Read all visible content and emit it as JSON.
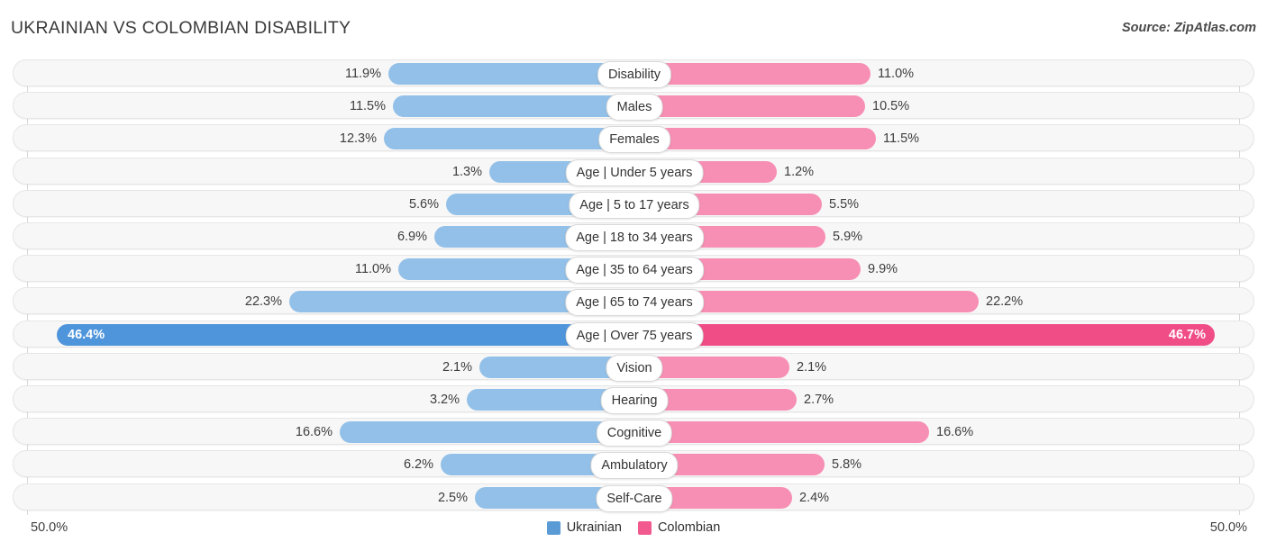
{
  "header": {
    "title": "UKRAINIAN VS COLOMBIAN DISABILITY",
    "source": "Source: ZipAtlas.com"
  },
  "axis": {
    "left_end": "50.0%",
    "right_end": "50.0%",
    "max": 50.0
  },
  "legend": {
    "items": [
      {
        "label": "Ukrainian",
        "color": "#5b9bd5"
      },
      {
        "label": "Colombian",
        "color": "#f2598f"
      }
    ]
  },
  "colors": {
    "left_bar": "#92c0e8",
    "left_bar_max": "#4e95db",
    "right_bar": "#f78eb4",
    "right_bar_max": "#f04d87",
    "row_track": "#f7f7f7",
    "gridline": "#d8d8d8"
  },
  "chart_data": {
    "type": "bar",
    "title": "UKRAINIAN VS COLOMBIAN DISABILITY",
    "subtitle": "Source: ZipAtlas.com",
    "orientation": "horizontal-diverging",
    "xlabel": "",
    "ylabel": "",
    "xlim": [
      50.0,
      50.0
    ],
    "grid": true,
    "legend_position": "bottom-center",
    "categories": [
      "Disability",
      "Males",
      "Females",
      "Age | Under 5 years",
      "Age | 5 to 17 years",
      "Age | 18 to 34 years",
      "Age | 35 to 64 years",
      "Age | 65 to 74 years",
      "Age | Over 75 years",
      "Vision",
      "Hearing",
      "Cognitive",
      "Ambulatory",
      "Self-Care"
    ],
    "series": [
      {
        "name": "Ukrainian",
        "values": [
          11.9,
          11.5,
          12.3,
          1.3,
          5.6,
          6.9,
          11.0,
          22.3,
          46.4,
          2.1,
          3.2,
          16.6,
          6.2,
          2.5
        ],
        "labels": [
          "11.9%",
          "11.5%",
          "12.3%",
          "1.3%",
          "5.6%",
          "6.9%",
          "11.0%",
          "22.3%",
          "46.4%",
          "2.1%",
          "3.2%",
          "16.6%",
          "6.2%",
          "2.5%"
        ]
      },
      {
        "name": "Colombian",
        "values": [
          11.0,
          10.5,
          11.5,
          1.2,
          5.5,
          5.9,
          9.9,
          22.2,
          46.7,
          2.1,
          2.7,
          16.6,
          5.8,
          2.4
        ],
        "labels": [
          "11.0%",
          "10.5%",
          "11.5%",
          "1.2%",
          "5.5%",
          "5.9%",
          "9.9%",
          "22.2%",
          "46.7%",
          "2.1%",
          "2.7%",
          "16.6%",
          "5.8%",
          "2.4%"
        ]
      }
    ]
  },
  "rows": [
    {
      "category": "Disability",
      "left_label": "11.9%",
      "right_label": "11.0%",
      "left_w": 273,
      "right_w": 262,
      "highlight": false
    },
    {
      "category": "Males",
      "left_label": "11.5%",
      "right_label": "10.5%",
      "left_w": 268,
      "right_w": 256,
      "highlight": false
    },
    {
      "category": "Females",
      "left_label": "12.3%",
      "right_label": "11.5%",
      "left_w": 278,
      "right_w": 268,
      "highlight": false
    },
    {
      "category": "Age | Under 5 years",
      "left_label": "1.3%",
      "right_label": "1.2%",
      "left_w": 161,
      "right_w": 158,
      "highlight": false
    },
    {
      "category": "Age | 5 to 17 years",
      "left_label": "5.6%",
      "right_label": "5.5%",
      "left_w": 209,
      "right_w": 208,
      "highlight": false
    },
    {
      "category": "Age | 18 to 34 years",
      "left_label": "6.9%",
      "right_label": "5.9%",
      "left_w": 222,
      "right_w": 212,
      "highlight": false
    },
    {
      "category": "Age | 35 to 64 years",
      "left_label": "11.0%",
      "right_label": "9.9%",
      "left_w": 262,
      "right_w": 251,
      "highlight": false
    },
    {
      "category": "Age | 65 to 74 years",
      "left_label": "22.3%",
      "right_label": "22.2%",
      "left_w": 383,
      "right_w": 382,
      "highlight": false
    },
    {
      "category": "Age | Over 75 years",
      "left_label": "46.4%",
      "right_label": "46.7%",
      "left_w": 641,
      "right_w": 644,
      "highlight": true
    },
    {
      "category": "Vision",
      "left_label": "2.1%",
      "right_label": "2.1%",
      "left_w": 172,
      "right_w": 172,
      "highlight": false
    },
    {
      "category": "Hearing",
      "left_label": "3.2%",
      "right_label": "2.7%",
      "left_w": 186,
      "right_w": 180,
      "highlight": false
    },
    {
      "category": "Cognitive",
      "left_label": "16.6%",
      "right_label": "16.6%",
      "left_w": 327,
      "right_w": 327,
      "highlight": false
    },
    {
      "category": "Ambulatory",
      "left_label": "6.2%",
      "right_label": "5.8%",
      "left_w": 215,
      "right_w": 211,
      "highlight": false
    },
    {
      "category": "Self-Care",
      "left_label": "2.5%",
      "right_label": "2.4%",
      "left_w": 177,
      "right_w": 175,
      "highlight": false
    }
  ]
}
